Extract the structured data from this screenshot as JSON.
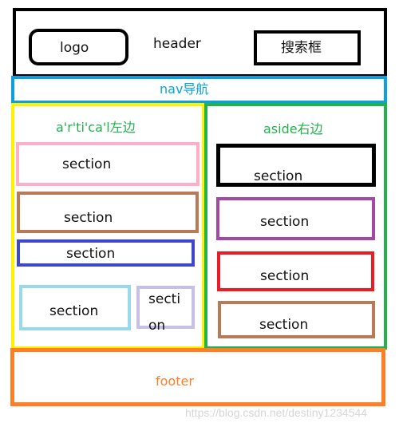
{
  "header": {
    "label": "header",
    "logo_label": "logo",
    "search_label": "搜索框",
    "border_color": "#000000"
  },
  "nav": {
    "label": "nav导航",
    "color": "#0aa0e2"
  },
  "article": {
    "label": "a'r'ti'ca'l左边",
    "border_color": "#fff200",
    "label_color": "#22b14c",
    "sections": [
      {
        "label": "section",
        "color": "#ffaec9"
      },
      {
        "label": "section",
        "color": "#b97a57"
      },
      {
        "label": "section",
        "color": "#3f48cc"
      },
      {
        "label": "section",
        "color": "#99d9ea"
      },
      {
        "label_line1": "secti",
        "label_line2": "on",
        "color": "#c8bfe7"
      }
    ]
  },
  "aside": {
    "label": "aside右边",
    "border_color": "#22b14c",
    "label_color": "#22b14c",
    "sections": [
      {
        "label": "section",
        "color": "#000000"
      },
      {
        "label": "section",
        "color": "#a349a4"
      },
      {
        "label": "section",
        "color": "#ed1c24"
      },
      {
        "label": "section",
        "color": "#b97a57"
      }
    ]
  },
  "footer": {
    "label": "footer",
    "color": "#ff7f27"
  },
  "watermark": "https://blog.csdn.net/destiny1234544"
}
